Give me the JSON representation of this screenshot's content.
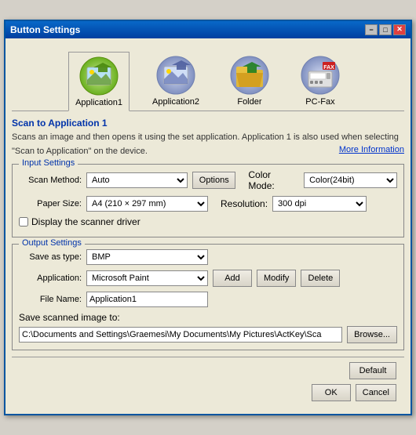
{
  "window": {
    "title": "Button Settings",
    "titlebar_buttons": {
      "minimize": "−",
      "maximize": "□",
      "close": "✕"
    }
  },
  "tabs": [
    {
      "id": "app1",
      "label": "Application1",
      "active": true
    },
    {
      "id": "app2",
      "label": "Application2",
      "active": false
    },
    {
      "id": "folder",
      "label": "Folder",
      "active": false
    },
    {
      "id": "pcfax",
      "label": "PC-Fax",
      "active": false
    }
  ],
  "section_title": "Scan to Application 1",
  "description_line1": "Scans an image and then opens it using the set application. Application 1 is also used when selecting",
  "description_line2": "\"Scan to Application\" on the device.",
  "more_info_label": "More Information",
  "input_settings": {
    "group_label": "Input Settings",
    "scan_method_label": "Scan Method:",
    "scan_method_value": "Auto",
    "options_label": "Options",
    "color_mode_label": "Color Mode:",
    "color_mode_value": "Color(24bit)",
    "paper_size_label": "Paper Size:",
    "paper_size_value": "A4 (210 × 297 mm)",
    "resolution_label": "Resolution:",
    "resolution_value": "300 dpi",
    "display_driver_label": "Display the scanner driver",
    "display_driver_checked": false
  },
  "output_settings": {
    "group_label": "Output Settings",
    "save_as_type_label": "Save as type:",
    "save_as_type_value": "BMP",
    "application_label": "Application:",
    "application_value": "Microsoft Paint",
    "add_label": "Add",
    "modify_label": "Modify",
    "delete_label": "Delete",
    "file_name_label": "File Name:",
    "file_name_value": "Application1",
    "save_to_label": "Save scanned image to:",
    "save_to_path": "C:\\Documents and Settings\\Graemesi\\My Documents\\My Pictures\\ActKey\\Sca",
    "browse_label": "Browse..."
  },
  "bottom_buttons": {
    "default_label": "Default",
    "ok_label": "OK",
    "cancel_label": "Cancel"
  }
}
